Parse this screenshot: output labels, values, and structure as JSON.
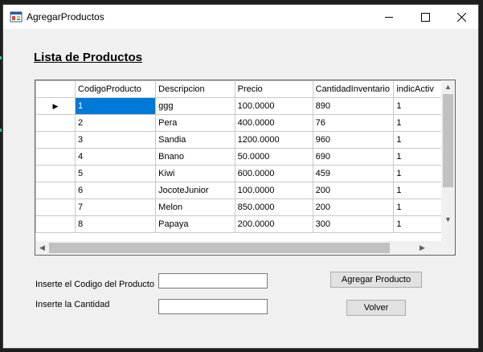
{
  "window": {
    "title": "AgregarProductos",
    "icon": "windows-form-icon",
    "controls": {
      "minimize": "minimize-icon",
      "maximize": "maximize-icon",
      "close": "close-icon"
    }
  },
  "heading": "Lista de Productos",
  "grid": {
    "columns": [
      "CodigoProducto",
      "Descripcion",
      "Precio",
      "CantidadInventario",
      "indicActiv"
    ],
    "rows": [
      [
        "1",
        "ggg",
        "100.0000",
        "890",
        "1"
      ],
      [
        "2",
        "Pera",
        "400.0000",
        "76",
        "1"
      ],
      [
        "3",
        "Sandia",
        "1200.0000",
        "960",
        "1"
      ],
      [
        "4",
        "Bnano",
        "50.0000",
        "690",
        "1"
      ],
      [
        "5",
        "Kiwi",
        "600.0000",
        "459",
        "1"
      ],
      [
        "6",
        "JocoteJunior",
        "100.0000",
        "200",
        "1"
      ],
      [
        "7",
        "Melon",
        "850.0000",
        "200",
        "1"
      ],
      [
        "8",
        "Papaya",
        "200.0000",
        "300",
        "1"
      ]
    ],
    "current_row_indicator": "row-pointer-icon"
  },
  "form": {
    "codigo_label": "Inserte el Codigo del Producto",
    "codigo_value": "",
    "cantidad_label": "Inserte la Cantidad",
    "cantidad_value": "",
    "agregar_button": "Agregar Producto",
    "volver_button": "Volver"
  },
  "colors": {
    "selection": "#0078d7",
    "background": "#f0f0f0"
  }
}
